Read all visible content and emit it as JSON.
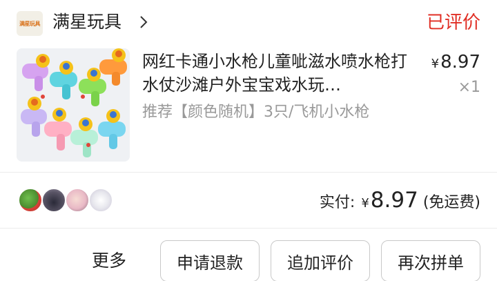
{
  "header": {
    "shop_logo_text": "满星玩具",
    "shop_name": "满星玩具",
    "status": "已评价",
    "status_color": "#e02e24"
  },
  "product": {
    "title": "网红卡通小水枪儿童呲滋水喷水枪打水仗沙滩户外宝宝戏水玩…",
    "spec": "推荐【颜色随机】3只/飞机小水枪",
    "price_symbol": "¥",
    "price": "8.97",
    "quantity": "×1"
  },
  "summary": {
    "paid_label": "实付:",
    "price_symbol": "¥",
    "paid_amount": "8.97",
    "shipping_note": "(免运费)"
  },
  "actions": {
    "more": "更多",
    "refund": "申请退款",
    "append_review": "追加评价",
    "regroup": "再次拼单"
  }
}
